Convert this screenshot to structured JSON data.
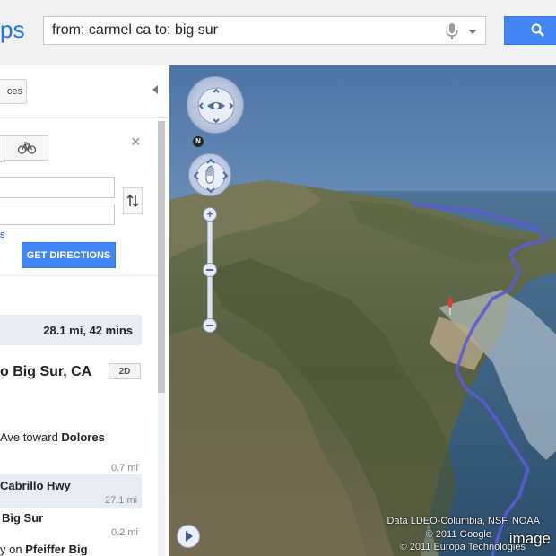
{
  "header": {
    "logo_text": "ps",
    "search_query": "from: carmel ca to: big sur",
    "icons": [
      "mic-icon",
      "dropdown-caret-icon",
      "search-icon"
    ]
  },
  "sidebar": {
    "places_label": "ces",
    "get_directions_label": "GET DIRECTIONS",
    "small_link": "s",
    "close_label": "×",
    "summary": "28.1 mi, 42 mins",
    "route_title": "o Big Sur, CA",
    "view_toggle": "2D",
    "steps": [
      {
        "pre": "Ave toward ",
        "bold": "Dolores",
        "distance": "0.7 mi"
      },
      {
        "text": "Cabrillo Hwy",
        "distance": "27.1 mi"
      },
      {
        "text": "Big Sur",
        "distance": "0.2 mi"
      },
      {
        "pre": "y on ",
        "bold": "Pfeiffer Big"
      }
    ]
  },
  "map": {
    "compass_label": "N",
    "attribution": [
      "Data LDEO-Columbia, NSF, NOAA",
      "© 2011 Google",
      "© 2011 Europa Technologies"
    ],
    "watermark": "image",
    "colors": {
      "route": "#5b5bd6",
      "sky_top": "#4e78a8",
      "ocean": "#3a6a9a"
    }
  }
}
